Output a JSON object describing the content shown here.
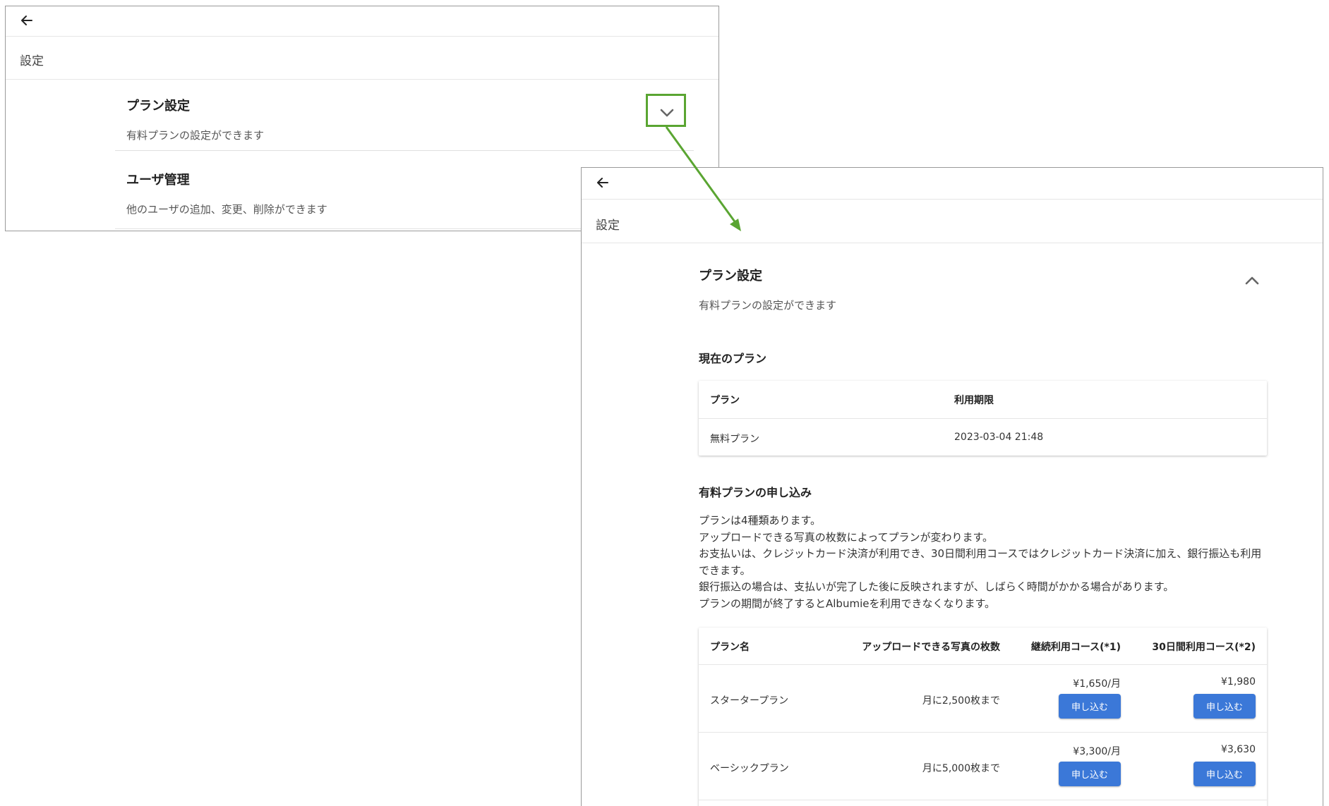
{
  "window_collapsed": {
    "header_title": "設定",
    "sections": [
      {
        "title": "プラン設定",
        "description": "有料プランの設定ができます"
      },
      {
        "title": "ユーザ管理",
        "description": "他のユーザの追加、変更、削除ができます"
      }
    ]
  },
  "window_expanded": {
    "header_title": "設定",
    "section": {
      "title": "プラン設定",
      "description": "有料プランの設定ができます"
    },
    "current_plan": {
      "heading": "現在のプラン",
      "columns": [
        "プラン",
        "利用期限"
      ],
      "rows": [
        [
          "無料プラン",
          "2023-03-04 21:48"
        ]
      ]
    },
    "paid_plans": {
      "heading": "有料プランの申し込み",
      "paragraphs": [
        "プランは4種類あります。",
        "アップロードできる写真の枚数によってプランが変わります。",
        "お支払いは、クレジットカード決済が利用でき、30日間利用コースではクレジットカード決済に加え、銀行振込も利用できます。",
        "銀行振込の場合は、支払いが完了した後に反映されますが、しばらく時間がかかる場合があります。",
        "プランの期間が終了するとAlbumieを利用できなくなります。"
      ],
      "columns": [
        "プラン名",
        "アップロードできる写真の枚数",
        "継続利用コース(*1)",
        "30日間利用コース(*2)"
      ],
      "plans": [
        {
          "name": "スタータープラン",
          "photos": "月に2,500枚まで",
          "monthly_price": "¥1,650/月",
          "thirty_day_price": "¥1,980",
          "button_label": "申し込む"
        },
        {
          "name": "ベーシックプラン",
          "photos": "月に5,000枚まで",
          "monthly_price": "¥3,300/月",
          "thirty_day_price": "¥3,630",
          "button_label": "申し込む"
        }
      ]
    }
  },
  "icons": {
    "back": "arrow-left-icon",
    "expand": "chevron-down-icon",
    "collapse": "chevron-up-icon"
  },
  "colors": {
    "highlight": "#5aa532",
    "primary_button": "#3b78d8"
  }
}
